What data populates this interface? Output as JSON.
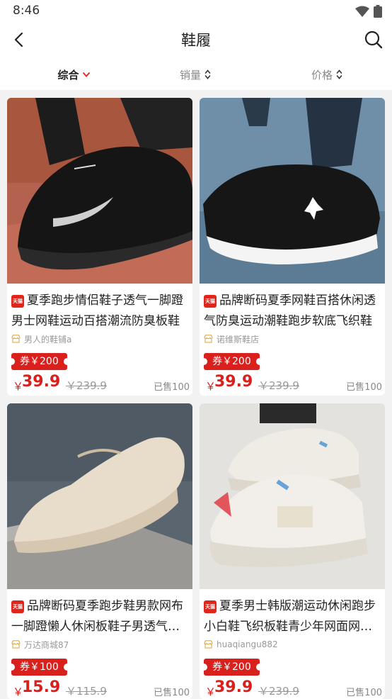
{
  "status": {
    "time": "8:46"
  },
  "nav": {
    "title": "鞋履"
  },
  "sort_tabs": [
    {
      "label": "综合",
      "active": true
    },
    {
      "label": "销量",
      "active": false
    },
    {
      "label": "价格",
      "active": false
    }
  ],
  "badge_text": "天猫",
  "products": [
    {
      "title": "夏季跑步情侣鞋子透气一脚蹬男士网鞋运动百搭潮流防臭板鞋",
      "shop": "男人的鞋铺a",
      "coupon": "券￥200",
      "currency": "￥",
      "price": "39.9",
      "original_price": "￥239.9",
      "sold": "已售100",
      "image": "black-nike-running-shoe-on-track"
    },
    {
      "title": "品牌断码夏季网鞋百搭休闲透气防臭运动潮鞋跑步软底飞织鞋",
      "shop": "诺维斯鞋店",
      "coupon": "券￥200",
      "currency": "￥",
      "price": "39.9",
      "original_price": "￥239.9",
      "sold": "已售100",
      "image": "black-jordan-running-shoe-on-pavement"
    },
    {
      "title": "品牌断码夏季跑步鞋男款网布一脚蹬懒人休闲板鞋子男透气运动鞋",
      "shop": "万达商城87",
      "coupon": "券￥100",
      "currency": "￥",
      "price": "15.9",
      "original_price": "￥115.9",
      "sold": "已售100",
      "image": "beige-knit-sneaker-on-concrete"
    },
    {
      "title": "夏季男士韩版潮运动休闲跑步小白鞋飞织板鞋青少年网面网鞋子",
      "shop": "huaqiangu882",
      "coupon": "券￥200",
      "currency": "￥",
      "price": "39.9",
      "original_price": "￥239.9",
      "sold": "已售100",
      "image": "white-social-man-sneakers-pair"
    }
  ],
  "colors": {
    "accent_red": "#d9201c",
    "tmall_red": "#e1251b",
    "background": "#f2f2f2"
  }
}
